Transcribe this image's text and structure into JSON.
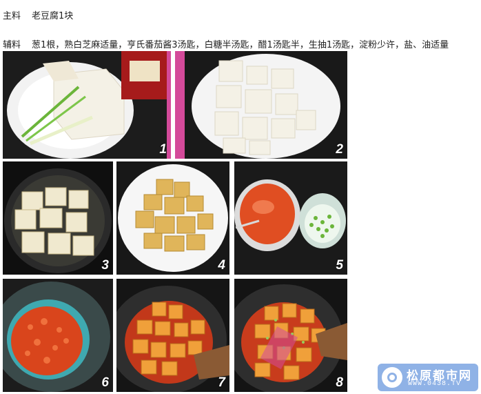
{
  "ingredients": {
    "main_label": "主料",
    "main_text": "老豆腐1块",
    "aux_label": "辅料",
    "aux_text": "葱1根，熟白芝麻适量，亨氏番茄酱3汤匙，白糖半汤匙，醋1汤匙半，生抽1汤匙，淀粉少许，盐、油适量"
  },
  "steps": [
    {
      "number": "1",
      "icon": "tofu-block-and-scallion-photo"
    },
    {
      "number": "2",
      "icon": "tofu-cubes-plate-photo"
    },
    {
      "number": "3",
      "icon": "frying-tofu-pan-photo"
    },
    {
      "number": "4",
      "icon": "fried-tofu-plate-photo"
    },
    {
      "number": "5",
      "icon": "tomato-sauce-and-scallion-photo"
    },
    {
      "number": "6",
      "icon": "simmering-sauce-wok-photo"
    },
    {
      "number": "7",
      "icon": "tofu-in-sauce-wok-photo"
    },
    {
      "number": "8",
      "icon": "finished-dish-wok-photo"
    }
  ],
  "watermark": {
    "name": "松原都市网",
    "url": "WWW.0438.TV",
    "color": "#8fb2e6"
  },
  "colors": {
    "tofu": "#f4f1e6",
    "fried_tofu": "#e0b55a",
    "sauce": "#e04e22",
    "scallion": "#6bb53a"
  }
}
